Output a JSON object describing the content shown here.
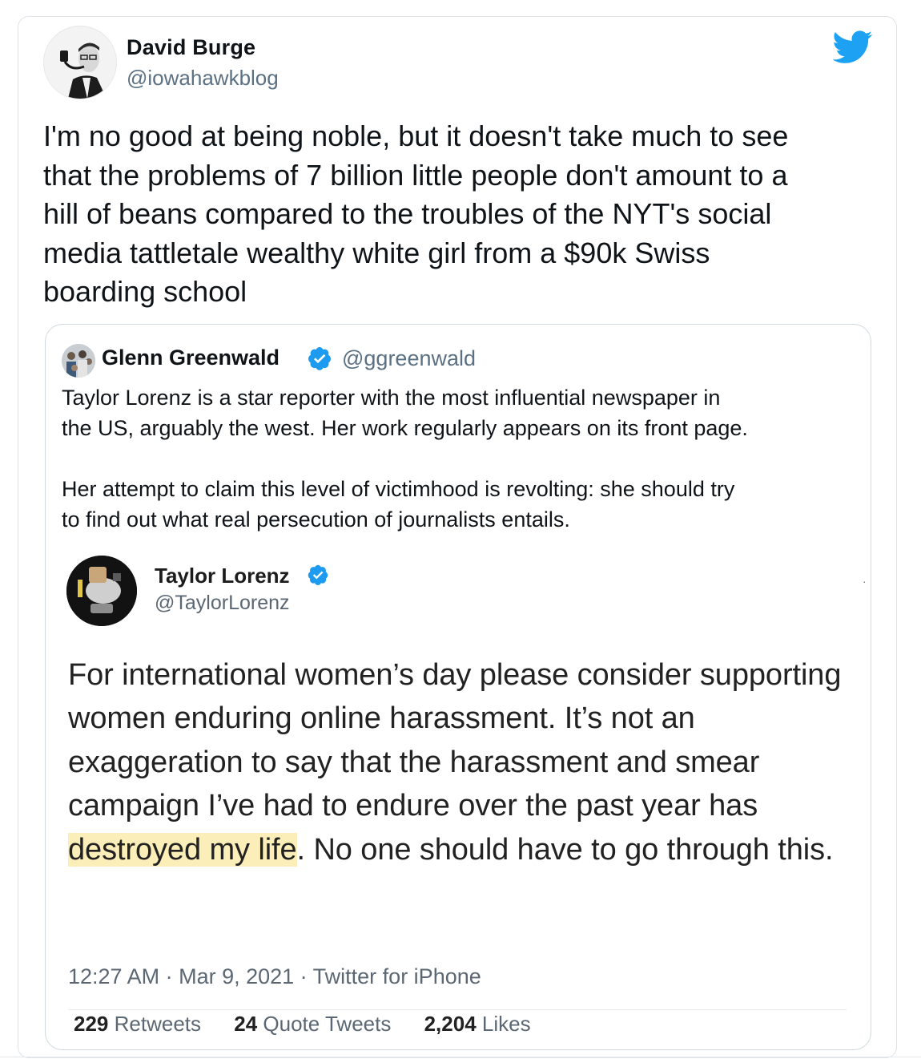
{
  "tweet": {
    "author_name": "David Burge",
    "author_handle": "@iowahawkblog",
    "text": "I'm no good at being noble, but it doesn't take much to see\nthat the problems of 7 billion little people don't amount to a\nhill of beans compared to the troubles of the NYT's social\nmedia tattletale wealthy white girl from a $90k Swiss\nboarding school"
  },
  "quoted": {
    "author_name": "Glenn Greenwald",
    "author_handle": "@ggreenwald",
    "text": "Taylor Lorenz is a star reporter with the most influential newspaper in\nthe US, arguably the west. Her work regularly appears on its front page.\n\nHer attempt to claim this level of victimhood is revolting: she should try\nto find out what real persecution of journalists entails."
  },
  "embedded": {
    "author_name": "Taylor Lorenz",
    "author_handle": "@TaylorLorenz",
    "text_before": "For international women’s day please consider supporting women enduring online harassment. It’s not an exaggeration to say that the harassment and smear campaign I’ve had to endure over the past year has ",
    "text_highlight": "destroyed my life",
    "text_after": ". No one should have to go through this.",
    "meta": "12:27 AM · Mar 9, 2021 · Twitter for iPhone",
    "retweets_count": "229",
    "retweets_label": "Retweets",
    "quotes_count": "24",
    "quotes_label": "Quote Tweets",
    "likes_count": "2,204",
    "likes_label": "Likes",
    "more_glyph": "·"
  },
  "colors": {
    "twitter_blue": "#1da1f2",
    "verified_blue": "#1d9bf0",
    "secondary_text": "#5b7083",
    "highlight": "#fbeeb8"
  },
  "icons": {
    "brand": "twitter-bird-icon",
    "verified": "verified-badge-icon"
  }
}
